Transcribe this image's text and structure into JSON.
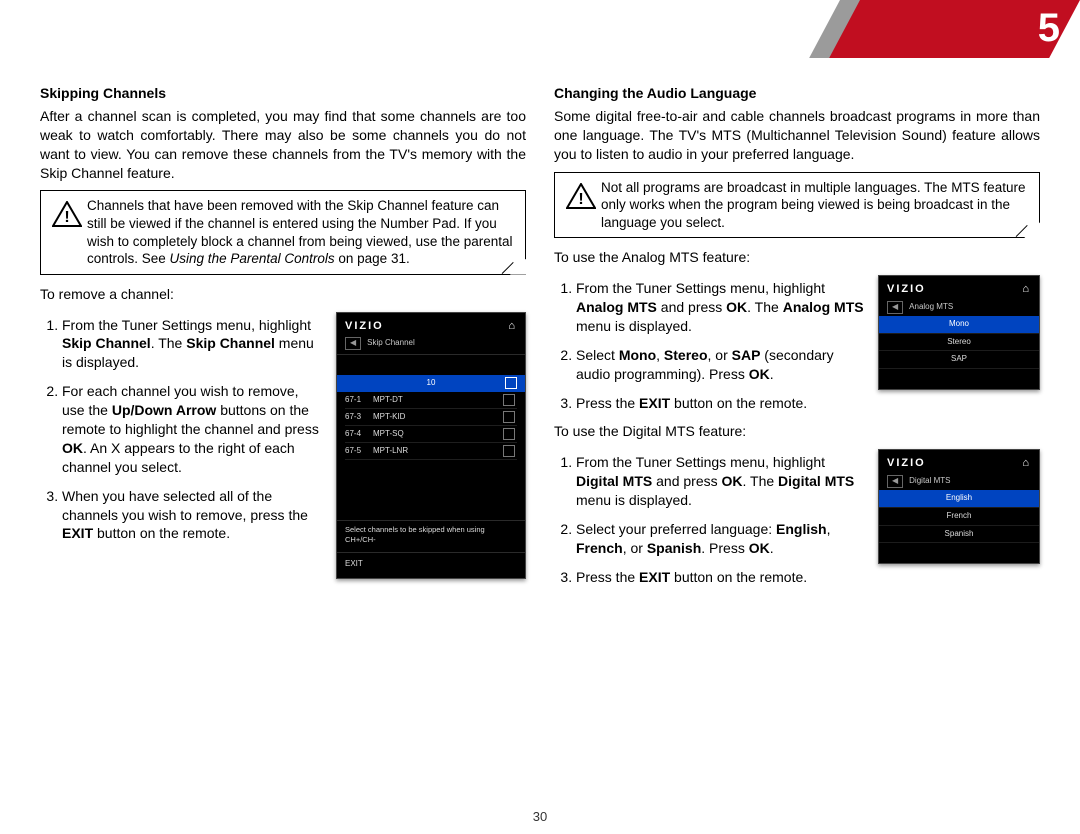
{
  "chapter": "5",
  "page_number": "30",
  "col1": {
    "h": "Skipping Channels",
    "intro": "After a channel scan is completed, you may find that some channels are too weak to watch comfortably. There may also be some channels you do not want to view. You can remove these channels from the TV's memory with the Skip Channel feature.",
    "callout_html": "Channels that have been removed with the Skip Channel feature can still be viewed if the channel is entered using the Number Pad. If you wish to completely block a channel from being viewed, use the parental controls. See <em>Using the Parental Controls</em> on page 31.",
    "lead": "To remove a channel:",
    "step1_html": "From the Tuner Settings menu, highlight <b>Skip Channel</b>. The <b>Skip Channel</b> menu is displayed.",
    "step2_html": "For each channel you wish to remove, use the <b>Up/Down Arrow</b> buttons on the remote to highlight the channel and press <b>OK</b>. An X appears to the right of each channel you select.",
    "step3_html": "When you have selected all of the channels you wish to remove, press the <b>EXIT</b> button on the remote.",
    "shot": {
      "logo": "VIZIO",
      "title": "Skip Channel",
      "home": "⌂",
      "back": "◀",
      "highlight_num": "10",
      "channels": [
        {
          "num": "67-1",
          "name": "MPT-DT"
        },
        {
          "num": "67-3",
          "name": "MPT-KID"
        },
        {
          "num": "67-4",
          "name": "MPT-SQ"
        },
        {
          "num": "67-5",
          "name": "MPT-LNR"
        }
      ],
      "hint": "Select channels to be skipped when using CH+/CH-",
      "exit": "EXIT"
    }
  },
  "col2": {
    "h": "Changing the Audio Language",
    "intro": "Some digital free-to-air and cable channels broadcast programs in more than one language. The TV's MTS (Multichannel Television Sound) feature allows you to listen to audio in your preferred language.",
    "callout_html": "Not all programs are broadcast in multiple languages. The MTS feature only works when the program being viewed is being broadcast in the language you select.",
    "analog": {
      "lead": "To use the Analog MTS feature:",
      "step1_html": "From the Tuner Settings menu, highlight <b>Analog MTS</b> and press <b>OK</b>. The <b>Analog MTS</b> menu is displayed.",
      "step2_html": "Select <b>Mono</b>, <b>Stereo</b>, or <b>SAP</b> (secondary audio programming). Press <b>OK</b>.",
      "step3_html": "Press the <b>EXIT</b> button on the remote.",
      "shot": {
        "logo": "VIZIO",
        "home": "⌂",
        "back": "◀",
        "title": "Analog MTS",
        "options": [
          {
            "t": "Mono",
            "sel": true
          },
          {
            "t": "Stereo",
            "sel": false
          },
          {
            "t": "SAP",
            "sel": false
          }
        ]
      }
    },
    "digital": {
      "lead": "To use the Digital MTS feature:",
      "step1_html": "From the Tuner Settings menu, highlight <b>Digital MTS</b> and press <b>OK</b>. The <b>Digital MTS</b> menu is displayed.",
      "step2_html": "Select your preferred language: <b>English</b>, <b>French</b>, or <b>Spanish</b>. Press <b>OK</b>.",
      "step3_html": "Press the <b>EXIT</b> button on the remote.",
      "shot": {
        "logo": "VIZIO",
        "home": "⌂",
        "back": "◀",
        "title": "Digital MTS",
        "options": [
          {
            "t": "English",
            "sel": true
          },
          {
            "t": "French",
            "sel": false
          },
          {
            "t": "Spanish",
            "sel": false
          }
        ]
      }
    }
  }
}
